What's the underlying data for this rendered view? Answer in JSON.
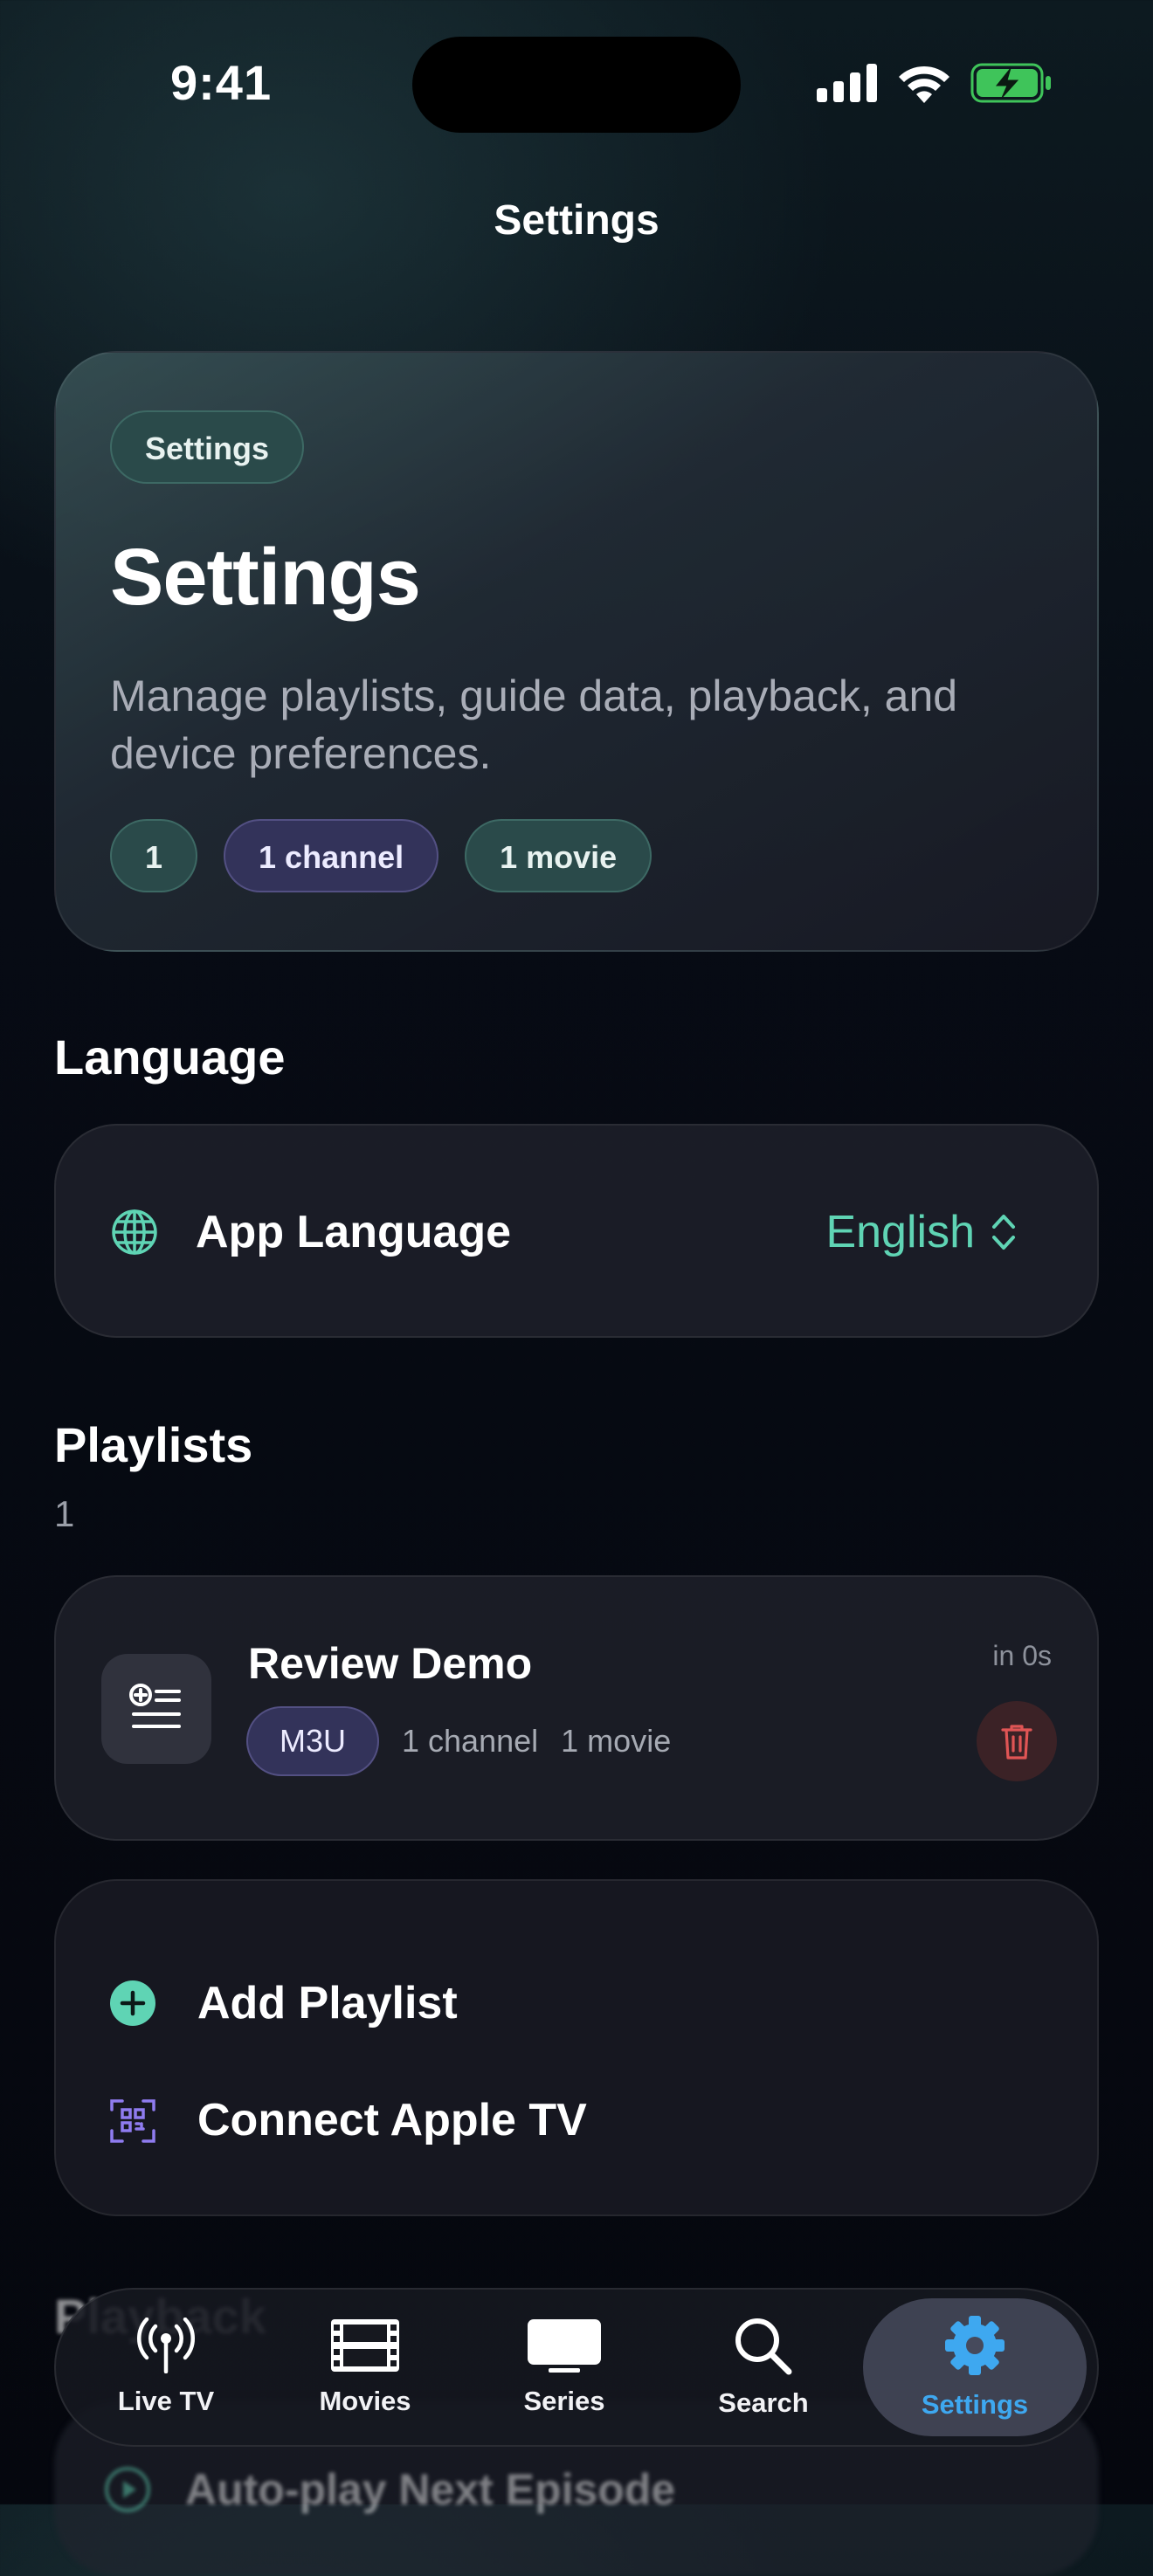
{
  "status_bar": {
    "time": "9:41"
  },
  "nav": {
    "title": "Settings"
  },
  "hero": {
    "badge": "Settings",
    "title": "Settings",
    "description": "Manage playlists, guide data, playback, and device preferences.",
    "chips": [
      "1",
      "1 channel",
      "1 movie"
    ]
  },
  "language": {
    "heading": "Language",
    "row_label": "App Language",
    "value": "English",
    "icon": "globe-icon"
  },
  "playlists": {
    "heading": "Playlists",
    "count": "1",
    "items": [
      {
        "name": "Review Demo",
        "type": "M3U",
        "channels": "1 channel",
        "movies": "1 movie",
        "updated": "in 0s"
      }
    ]
  },
  "actions": {
    "add_playlist": "Add Playlist",
    "connect_apple_tv": "Connect Apple TV"
  },
  "peek": {
    "heading": "Playback",
    "row_label": "Auto-play Next Episode"
  },
  "tabs": [
    {
      "label": "Live TV",
      "icon": "antenna-icon",
      "active": false
    },
    {
      "label": "Movies",
      "icon": "film-icon",
      "active": false
    },
    {
      "label": "Series",
      "icon": "tv-icon",
      "active": false
    },
    {
      "label": "Search",
      "icon": "search-icon",
      "active": false
    },
    {
      "label": "Settings",
      "icon": "gear-icon",
      "active": true
    }
  ],
  "colors": {
    "accent": "#5fd4b4",
    "tab_active": "#3ea8f0",
    "danger": "#e05555",
    "qr": "#8f7cf0"
  }
}
